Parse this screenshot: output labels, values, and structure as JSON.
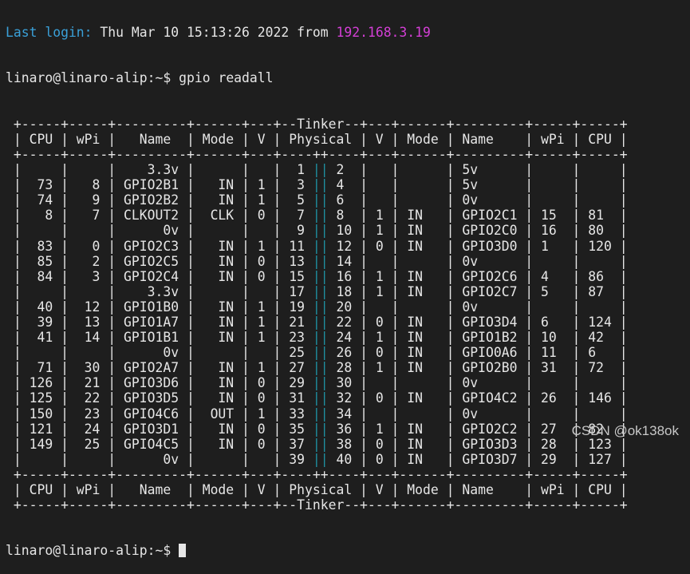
{
  "terminal": {
    "last_login": {
      "label": "Last login:",
      "text": " Thu Mar 10 15:13:26 2022 from ",
      "ip": "192.168.3.19"
    },
    "prompt": "linaro@linaro-alip:~$ ",
    "command": "gpio readall",
    "board_name": "Tinker",
    "headers": {
      "left": [
        "CPU",
        "wPi",
        "Name",
        "Mode",
        "V"
      ],
      "center": "Physical",
      "right": [
        "V",
        "Mode",
        "Name",
        "wPi",
        "CPU"
      ]
    },
    "rows": [
      {
        "lcpu": "",
        "lwpi": "",
        "lname": "3.3v",
        "lmode": "",
        "lv": "",
        "lpin": "1",
        "rpin": "2",
        "rv": "",
        "rmode": "",
        "rname": "5v",
        "rwpi": "",
        "rcpu": ""
      },
      {
        "lcpu": "73",
        "lwpi": "8",
        "lname": "GPIO2B1",
        "lmode": "IN",
        "lv": "1",
        "lpin": "3",
        "rpin": "4",
        "rv": "",
        "rmode": "",
        "rname": "5v",
        "rwpi": "",
        "rcpu": ""
      },
      {
        "lcpu": "74",
        "lwpi": "9",
        "lname": "GPIO2B2",
        "lmode": "IN",
        "lv": "1",
        "lpin": "5",
        "rpin": "6",
        "rv": "",
        "rmode": "",
        "rname": "0v",
        "rwpi": "",
        "rcpu": ""
      },
      {
        "lcpu": "8",
        "lwpi": "7",
        "lname": "CLKOUT2",
        "lmode": "CLK",
        "lv": "0",
        "lpin": "7",
        "rpin": "8",
        "rv": "1",
        "rmode": "IN",
        "rname": "GPIO2C1",
        "rwpi": "15",
        "rcpu": "81"
      },
      {
        "lcpu": "",
        "lwpi": "",
        "lname": "0v",
        "lmode": "",
        "lv": "",
        "lpin": "9",
        "rpin": "10",
        "rv": "1",
        "rmode": "IN",
        "rname": "GPIO2C0",
        "rwpi": "16",
        "rcpu": "80"
      },
      {
        "lcpu": "83",
        "lwpi": "0",
        "lname": "GPIO2C3",
        "lmode": "IN",
        "lv": "1",
        "lpin": "11",
        "rpin": "12",
        "rv": "0",
        "rmode": "IN",
        "rname": "GPIO3D0",
        "rwpi": "1",
        "rcpu": "120"
      },
      {
        "lcpu": "85",
        "lwpi": "2",
        "lname": "GPIO2C5",
        "lmode": "IN",
        "lv": "0",
        "lpin": "13",
        "rpin": "14",
        "rv": "",
        "rmode": "",
        "rname": "0v",
        "rwpi": "",
        "rcpu": ""
      },
      {
        "lcpu": "84",
        "lwpi": "3",
        "lname": "GPIO2C4",
        "lmode": "IN",
        "lv": "0",
        "lpin": "15",
        "rpin": "16",
        "rv": "1",
        "rmode": "IN",
        "rname": "GPIO2C6",
        "rwpi": "4",
        "rcpu": "86"
      },
      {
        "lcpu": "",
        "lwpi": "",
        "lname": "3.3v",
        "lmode": "",
        "lv": "",
        "lpin": "17",
        "rpin": "18",
        "rv": "1",
        "rmode": "IN",
        "rname": "GPIO2C7",
        "rwpi": "5",
        "rcpu": "87"
      },
      {
        "lcpu": "40",
        "lwpi": "12",
        "lname": "GPIO1B0",
        "lmode": "IN",
        "lv": "1",
        "lpin": "19",
        "rpin": "20",
        "rv": "",
        "rmode": "",
        "rname": "0v",
        "rwpi": "",
        "rcpu": ""
      },
      {
        "lcpu": "39",
        "lwpi": "13",
        "lname": "GPIO1A7",
        "lmode": "IN",
        "lv": "1",
        "lpin": "21",
        "rpin": "22",
        "rv": "0",
        "rmode": "IN",
        "rname": "GPIO3D4",
        "rwpi": "6",
        "rcpu": "124"
      },
      {
        "lcpu": "41",
        "lwpi": "14",
        "lname": "GPIO1B1",
        "lmode": "IN",
        "lv": "1",
        "lpin": "23",
        "rpin": "24",
        "rv": "1",
        "rmode": "IN",
        "rname": "GPIO1B2",
        "rwpi": "10",
        "rcpu": "42"
      },
      {
        "lcpu": "",
        "lwpi": "",
        "lname": "0v",
        "lmode": "",
        "lv": "",
        "lpin": "25",
        "rpin": "26",
        "rv": "0",
        "rmode": "IN",
        "rname": "GPIO0A6",
        "rwpi": "11",
        "rcpu": "6"
      },
      {
        "lcpu": "71",
        "lwpi": "30",
        "lname": "GPIO2A7",
        "lmode": "IN",
        "lv": "1",
        "lpin": "27",
        "rpin": "28",
        "rv": "1",
        "rmode": "IN",
        "rname": "GPIO2B0",
        "rwpi": "31",
        "rcpu": "72"
      },
      {
        "lcpu": "126",
        "lwpi": "21",
        "lname": "GPIO3D6",
        "lmode": "IN",
        "lv": "0",
        "lpin": "29",
        "rpin": "30",
        "rv": "",
        "rmode": "",
        "rname": "0v",
        "rwpi": "",
        "rcpu": ""
      },
      {
        "lcpu": "125",
        "lwpi": "22",
        "lname": "GPIO3D5",
        "lmode": "IN",
        "lv": "0",
        "lpin": "31",
        "rpin": "32",
        "rv": "0",
        "rmode": "IN",
        "rname": "GPIO4C2",
        "rwpi": "26",
        "rcpu": "146"
      },
      {
        "lcpu": "150",
        "lwpi": "23",
        "lname": "GPIO4C6",
        "lmode": "OUT",
        "lv": "1",
        "lpin": "33",
        "rpin": "34",
        "rv": "",
        "rmode": "",
        "rname": "0v",
        "rwpi": "",
        "rcpu": ""
      },
      {
        "lcpu": "121",
        "lwpi": "24",
        "lname": "GPIO3D1",
        "lmode": "IN",
        "lv": "0",
        "lpin": "35",
        "rpin": "36",
        "rv": "1",
        "rmode": "IN",
        "rname": "GPIO2C2",
        "rwpi": "27",
        "rcpu": "82"
      },
      {
        "lcpu": "149",
        "lwpi": "25",
        "lname": "GPIO4C5",
        "lmode": "IN",
        "lv": "0",
        "lpin": "37",
        "rpin": "38",
        "rv": "0",
        "rmode": "IN",
        "rname": "GPIO3D3",
        "rwpi": "28",
        "rcpu": "123"
      },
      {
        "lcpu": "",
        "lwpi": "",
        "lname": "0v",
        "lmode": "",
        "lv": "",
        "lpin": "39",
        "rpin": "40",
        "rv": "0",
        "rmode": "IN",
        "rname": "GPIO3D7",
        "rwpi": "29",
        "rcpu": "127"
      }
    ]
  },
  "watermark": "CSDN @ok138ok",
  "colors": {
    "background": "#1e1e1e",
    "foreground": "#e6e6e6",
    "login_label": "#3aa0d8",
    "ip": "#d43fd6",
    "pin_separator": "#1f8fa0"
  }
}
